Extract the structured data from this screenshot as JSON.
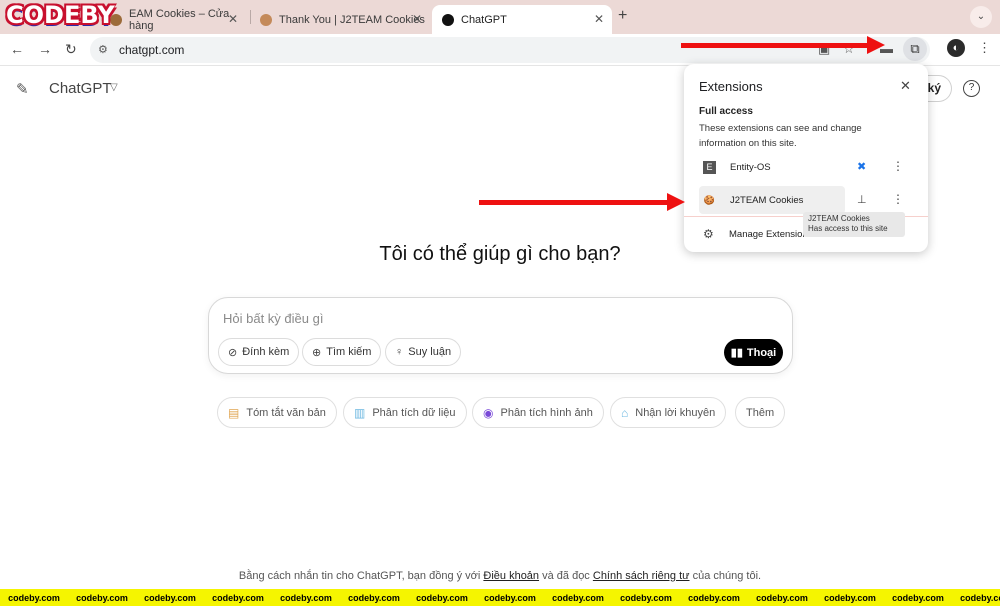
{
  "watermark": {
    "logo": "CODEBY",
    "banner_text": "codeby.com"
  },
  "browser": {
    "tabs": [
      {
        "title": "EAM Cookies – Cửa hàng"
      },
      {
        "title": "Thank You | J2TEAM Cookies"
      },
      {
        "title": "ChatGPT"
      }
    ],
    "url": "chatgpt.com"
  },
  "page": {
    "app_title": "ChatGPT",
    "signup_label": "ký",
    "help_label": "?",
    "headline": "Tôi có thể giúp gì cho bạn?",
    "composer": {
      "placeholder": "Hỏi bất kỳ điều gì",
      "attach_label": "Đính kèm",
      "search_label": "Tìm kiếm",
      "reason_label": "Suy luận",
      "voice_label": "Thoại"
    },
    "suggestions": [
      {
        "label": "Tóm tắt văn bản",
        "icon": "document-icon",
        "color": "#e0a552"
      },
      {
        "label": "Phân tích dữ liệu",
        "icon": "chart-icon",
        "color": "#6cb7e0"
      },
      {
        "label": "Phân tích hình ảnh",
        "icon": "eye-icon",
        "color": "#7a4ad8"
      },
      {
        "label": "Nhận lời khuyên",
        "icon": "graduation-cap-icon",
        "color": "#6cb7e0"
      },
      {
        "label": "Thêm",
        "icon": "",
        "color": "#555555"
      }
    ],
    "footer": {
      "prefix": "Bằng cách nhắn tin cho ChatGPT, bạn đồng ý với",
      "terms": "Điều khoản",
      "middle": "và đã đọc",
      "privacy": "Chính sách riêng tư",
      "suffix": "của chúng tôi."
    }
  },
  "extensions_popup": {
    "title": "Extensions",
    "section": "Full access",
    "description": "These extensions can see and change information on this site.",
    "items": [
      {
        "name": "Entity-OS",
        "icon_letter": "E"
      },
      {
        "name": "J2TEAM Cookies",
        "icon_letter": "🍪"
      }
    ],
    "manage_label": "Manage Extensions",
    "tooltip_title": "J2TEAM Cookies",
    "tooltip_body": "Has access to this site"
  },
  "colors": {
    "arrow": "#ee1111",
    "tabstrip": "#ecd9d6",
    "banner": "#f5f500"
  }
}
